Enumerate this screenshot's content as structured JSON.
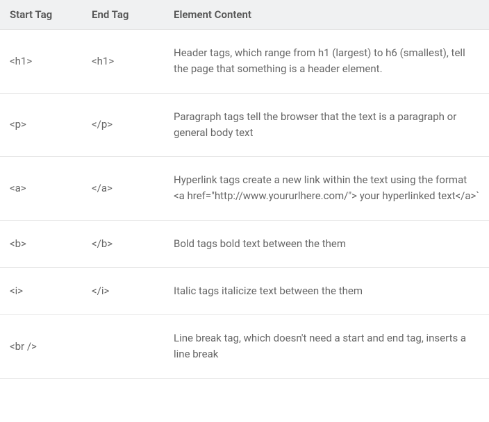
{
  "table": {
    "headers": {
      "start_tag": "Start Tag",
      "end_tag": "End Tag",
      "element_content": "Element Content"
    },
    "rows": [
      {
        "start": "<h1>",
        "end": "<h1>",
        "desc": "Header tags, which range from h1 (largest) to h6 (smallest), tell the page that something is a header element."
      },
      {
        "start": "<p>",
        "end": "</p>",
        "desc": "Paragraph tags tell the browser that the text is a paragraph or general body text"
      },
      {
        "start": "<a>",
        "end": "</a>",
        "desc": "Hyperlink tags create a new link within the text using the format <a href=\"http://www.yoururlhere.com/\"> your hyperlinked text</a>`"
      },
      {
        "start": "<b>",
        "end": "</b>",
        "desc": "Bold tags bold text between the them"
      },
      {
        "start": "<i>",
        "end": "</i>",
        "desc": "Italic tags italicize text between the them"
      },
      {
        "start": "<br />",
        "end": "",
        "desc": "Line break tag, which doesn't need a start and end tag, inserts a line break"
      }
    ]
  }
}
